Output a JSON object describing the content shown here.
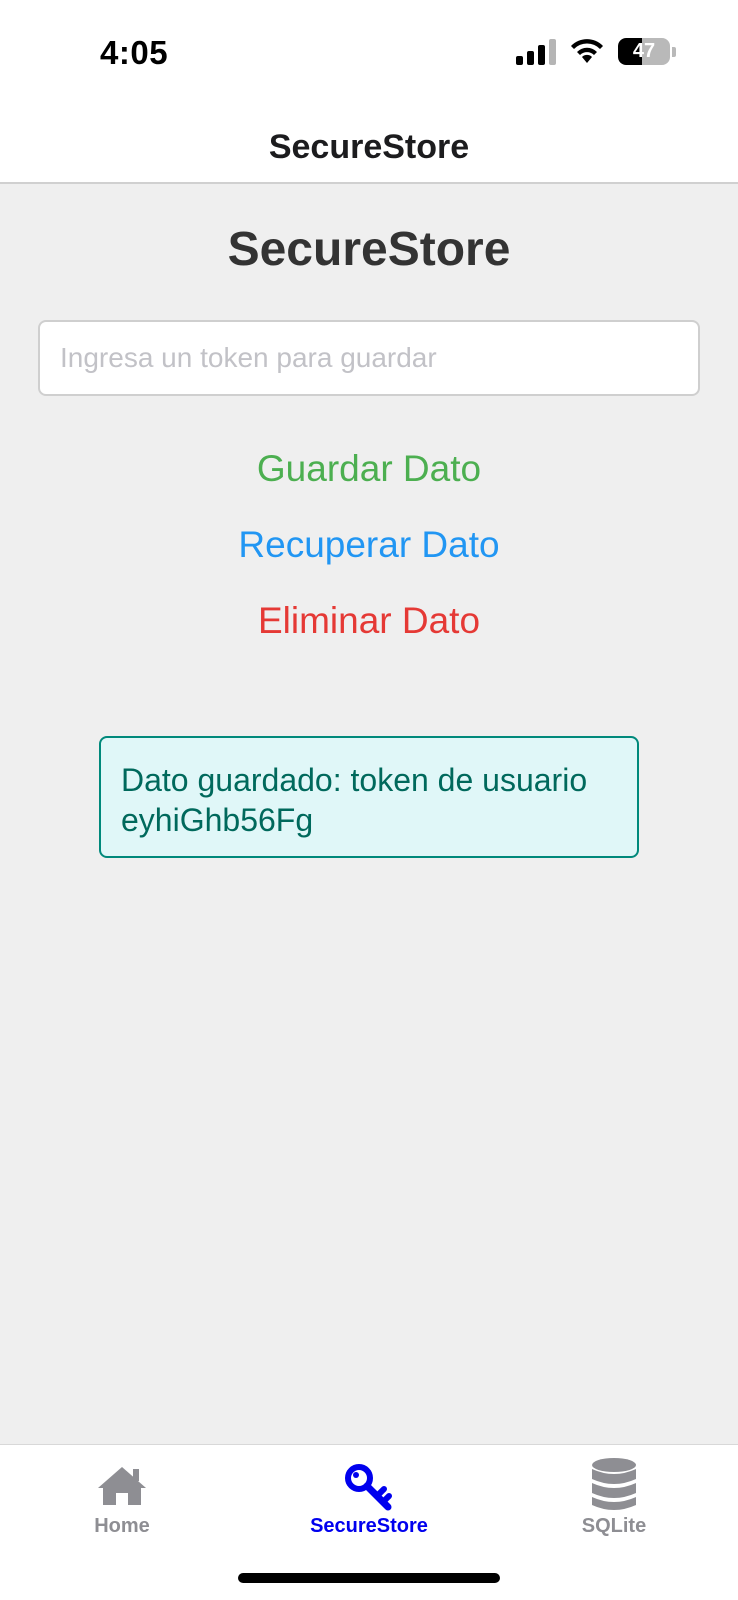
{
  "status_bar": {
    "time": "4:05",
    "battery_percent": "47",
    "battery_level": 0.47,
    "signal_bars_active": 3,
    "signal_bars_total": 4
  },
  "header": {
    "title": "SecureStore"
  },
  "main": {
    "title": "SecureStore",
    "input": {
      "placeholder": "Ingresa un token para guardar",
      "value": ""
    },
    "buttons": {
      "save": "Guardar Dato",
      "retrieve": "Recuperar Dato",
      "delete": "Eliminar Dato"
    },
    "result": "Dato guardado: token de usuario eyhiGhb56Fg"
  },
  "tab_bar": {
    "tabs": [
      {
        "label": "Home",
        "icon": "home-icon",
        "active": false
      },
      {
        "label": "SecureStore",
        "icon": "key-icon",
        "active": true
      },
      {
        "label": "SQLite",
        "icon": "database-icon",
        "active": false
      }
    ]
  },
  "colors": {
    "save": "#4caf50",
    "retrieve": "#2196f3",
    "delete": "#e53935",
    "result_text": "#00695c",
    "result_bg": "#e0f7f8",
    "tab_active": "#0000ee",
    "tab_inactive": "#8e8e93"
  }
}
